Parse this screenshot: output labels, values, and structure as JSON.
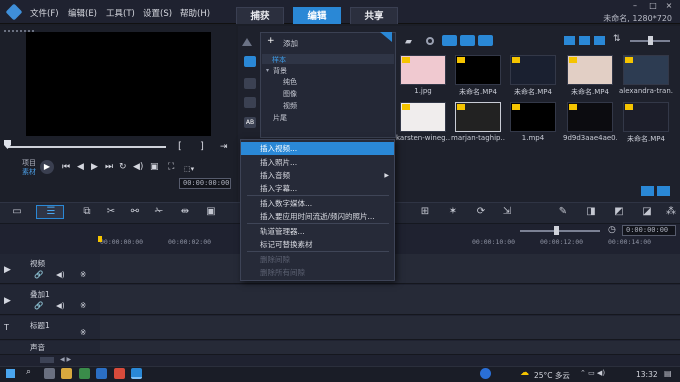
{
  "menubar": [
    "文件(F)",
    "编辑(E)",
    "工具(T)",
    "设置(S)",
    "帮助(H)"
  ],
  "tabs": [
    "捕获",
    "编辑",
    "共享"
  ],
  "project_info": "未命名, 1280*720",
  "preview": {
    "bracket_left": "[",
    "bracket_right": "]",
    "project_label": "项目",
    "clip_label": "素材",
    "timecode": "00:00:00:00"
  },
  "library": {
    "add_label": "添加",
    "tree": [
      "样本",
      "背景",
      "纯色",
      "图像",
      "视频",
      "片尾"
    ],
    "thumbnails": [
      {
        "label": "1.jpg",
        "color": "#f0c9d0"
      },
      {
        "label": "未命名.MP4",
        "color": "#000000"
      },
      {
        "label": "未命名.MP4",
        "color": "#1a2030"
      },
      {
        "label": "未命名.MP4",
        "color": "#e2cfc5"
      },
      {
        "label": "alexandra-tran...",
        "color": "#2d3c52"
      },
      {
        "label": "karsten-wineg...",
        "color": "#f0eded"
      },
      {
        "label": "marjan-taghip...",
        "color": "#222222"
      },
      {
        "label": "1.mp4",
        "color": "#000000"
      },
      {
        "label": "9d9d3aae4ae0...",
        "color": "#0c0c10"
      },
      {
        "label": "未命名.MP4",
        "color": "#1c1e2a"
      }
    ]
  },
  "context_menu": {
    "items": [
      {
        "label": "插入视频...",
        "state": "highlight"
      },
      {
        "label": "插入照片...",
        "state": "normal"
      },
      {
        "label": "插入音频",
        "state": "normal",
        "submenu": true
      },
      {
        "label": "插入字幕...",
        "state": "normal"
      },
      {
        "label": "插入数字媒体...",
        "state": "normal"
      },
      {
        "label": "插入要应用时间流逝/频闪的照片...",
        "state": "normal"
      },
      {
        "label": "轨道管理器...",
        "state": "normal"
      },
      {
        "label": "标记可替换素材",
        "state": "normal"
      },
      {
        "label": "删除间隙",
        "state": "disabled"
      },
      {
        "label": "删除所有间隙",
        "state": "disabled"
      }
    ]
  },
  "timeline": {
    "ruler": [
      "00:00:00:00",
      "00:00:02:00",
      "00:00:10:00",
      "00:00:12:00",
      "00:00:14:00"
    ],
    "right_timecode": "0:00:00:00",
    "tracks": [
      "视频",
      "叠加1",
      "标题1",
      "声音"
    ]
  },
  "taskbar": {
    "weather": "25°C 多云",
    "time": "13:32"
  }
}
